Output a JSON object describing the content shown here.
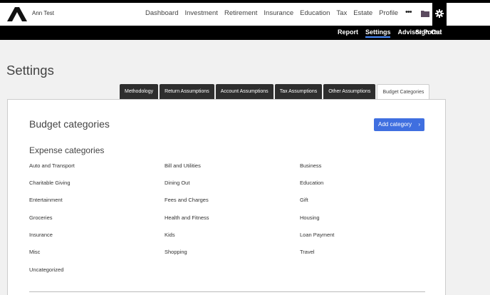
{
  "user": {
    "name": "Ann Test"
  },
  "nav": {
    "links": [
      "Dashboard",
      "Investment",
      "Retirement",
      "Insurance",
      "Education",
      "Tax",
      "Estate",
      "Profile"
    ],
    "more": "•••"
  },
  "subnav": {
    "links": [
      "Report",
      "Settings",
      "Advisor Portal"
    ],
    "active": "Settings",
    "signout": "Sign Out"
  },
  "page": {
    "title": "Settings"
  },
  "tabs": [
    "Methodology",
    "Return Assumptions",
    "Account Assumptions",
    "Tax Assumptions",
    "Other Assumptions",
    "Budget Categories"
  ],
  "selected_tab": "Budget Categories",
  "panel": {
    "title": "Budget categories",
    "add_button": "Add category",
    "subtitle": "Expense categories",
    "categories": [
      [
        "Auto and Transport",
        "Bill and Utilities",
        "Business"
      ],
      [
        "Charitable Giving",
        "Dining Out",
        "Education"
      ],
      [
        "Entertainment",
        "Fees and Charges",
        "Gift"
      ],
      [
        "Groceries",
        "Health and Fitness",
        "Housing"
      ],
      [
        "Insurance",
        "Kids",
        "Loan Payment"
      ],
      [
        "Misc",
        "Shopping",
        "Travel"
      ],
      [
        "Uncategorized"
      ]
    ]
  },
  "colors": {
    "accent": "#3f6fe0",
    "nav_dark": "#000000",
    "tab_dark": "#2e2e2e"
  }
}
